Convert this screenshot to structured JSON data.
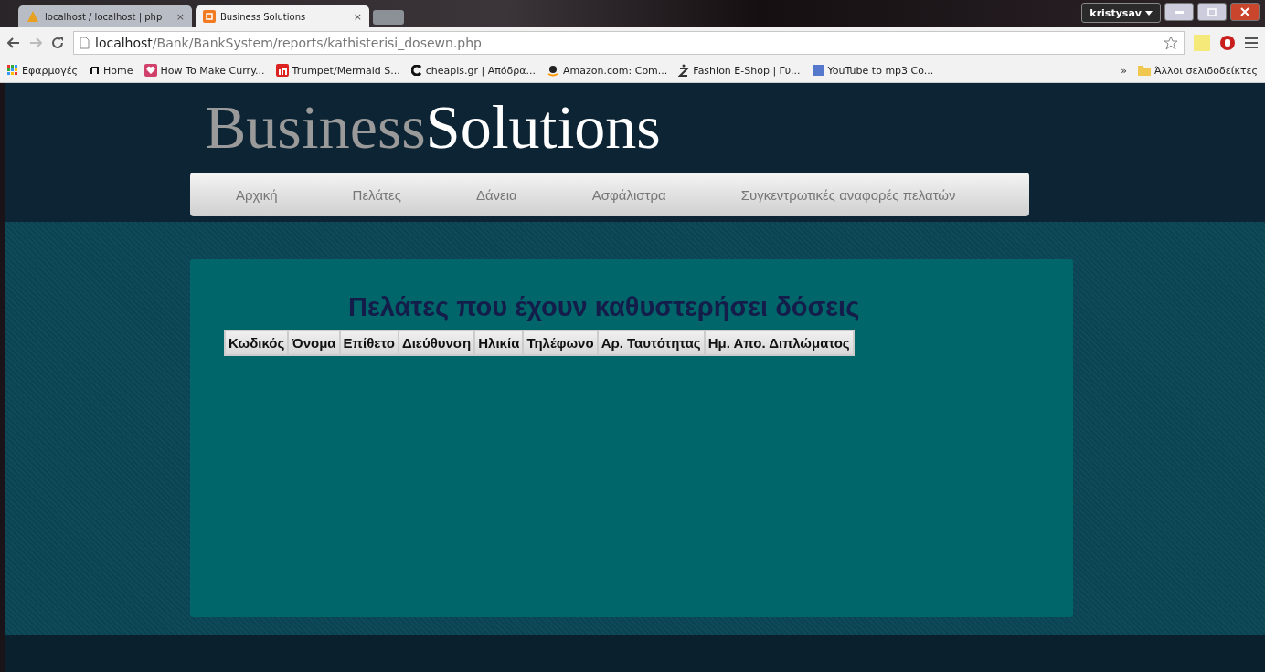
{
  "browser": {
    "tabs": [
      {
        "title": "localhost / localhost | php",
        "selected": false,
        "kind": "pma",
        "close": "×"
      },
      {
        "title": "Business Solutions",
        "selected": true,
        "kind": "site",
        "close": "×"
      }
    ],
    "user": "kristysav",
    "url": {
      "host": "localhost",
      "path": "/Bank/BankSystem/reports/kathisterisi_dosewn.php"
    },
    "bookmarks": [
      {
        "label": "Εφαρμογές",
        "kind": "apps"
      },
      {
        "label": "Home",
        "kind": "music"
      },
      {
        "label": "How To Make Curry...",
        "kind": "heart"
      },
      {
        "label": "Trumpet/Mermaid S...",
        "kind": "in"
      },
      {
        "label": "cheapis.gr | Απόδρα...",
        "kind": "c"
      },
      {
        "label": "Amazon.com: Com...",
        "kind": "amazon"
      },
      {
        "label": "Fashion E-Shop | Γυ...",
        "kind": "z"
      },
      {
        "label": "YouTube to mp3 Co...",
        "kind": "yt"
      }
    ],
    "overflow": "»",
    "other_bookmarks": "Άλλοι σελιδοδείκτες"
  },
  "site": {
    "logo": [
      "Business",
      "Solutions"
    ],
    "nav": [
      "Αρχική",
      "Πελάτες",
      "Δάνεια",
      "Ασφάλιστρα",
      "Συγκεντρωτικές αναφορές πελατών"
    ],
    "heading": "Πελάτες που έχουν καθυστερήσει δόσεις",
    "table": {
      "columns": [
        "Κωδικός",
        "Όνομα",
        "Επίθετο",
        "Διεύθυνση",
        "Ηλικία",
        "Τηλέφωνο",
        "Αρ. Ταυτότητας",
        "Ημ. Απο. Διπλώματος"
      ]
    }
  }
}
